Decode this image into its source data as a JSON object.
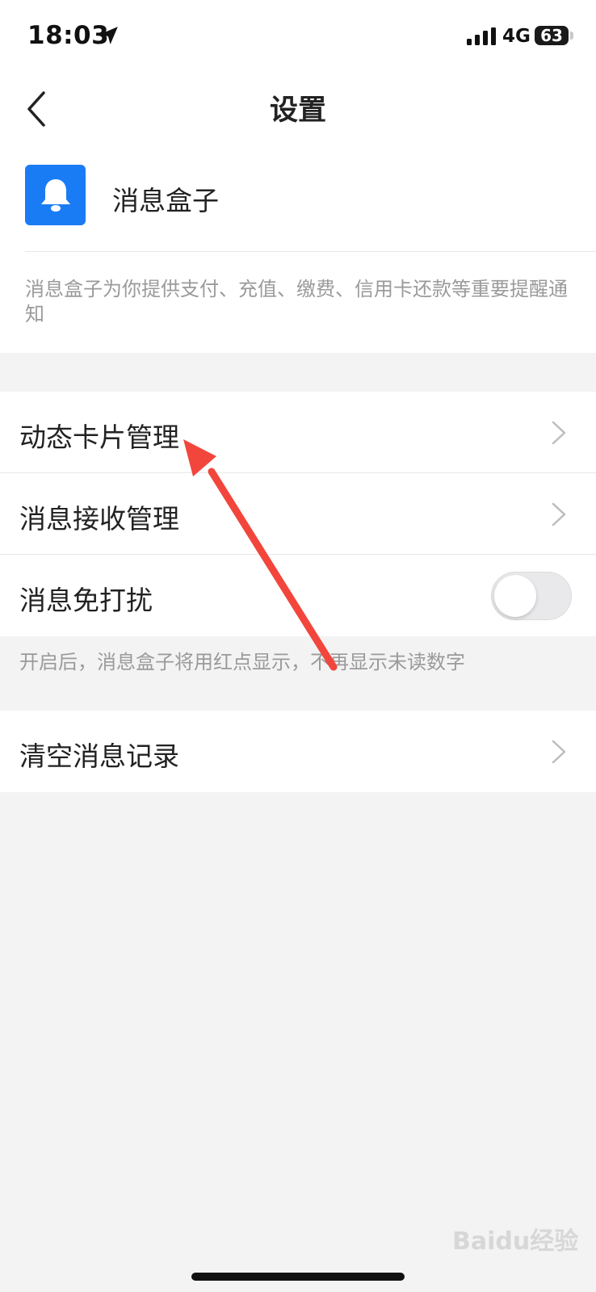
{
  "status_bar": {
    "time": "18:03",
    "network": "4G",
    "battery": "63",
    "location_icon": "location-arrow-icon",
    "signal_icon": "signal-bars-icon"
  },
  "nav": {
    "title": "设置",
    "back_icon": "chevron-left-icon"
  },
  "header": {
    "app_icon": "bell-icon",
    "app_icon_color": "#1a7cf5",
    "app_name": "消息盒子",
    "description": "消息盒子为你提供支付、充值、缴费、信用卡还款等重要提醒通知"
  },
  "settings": {
    "items": [
      {
        "label": "动态卡片管理",
        "type": "link"
      },
      {
        "label": "消息接收管理",
        "type": "link"
      },
      {
        "label": "消息免打扰",
        "type": "toggle",
        "enabled": false
      }
    ],
    "dnd_hint": "开启后，消息盒子将用红点显示，不再显示未读数字",
    "clear_history": {
      "label": "清空消息记录",
      "type": "link"
    }
  },
  "annotation": {
    "arrow_color": "#f2463d"
  },
  "watermark": "Baidu经验"
}
